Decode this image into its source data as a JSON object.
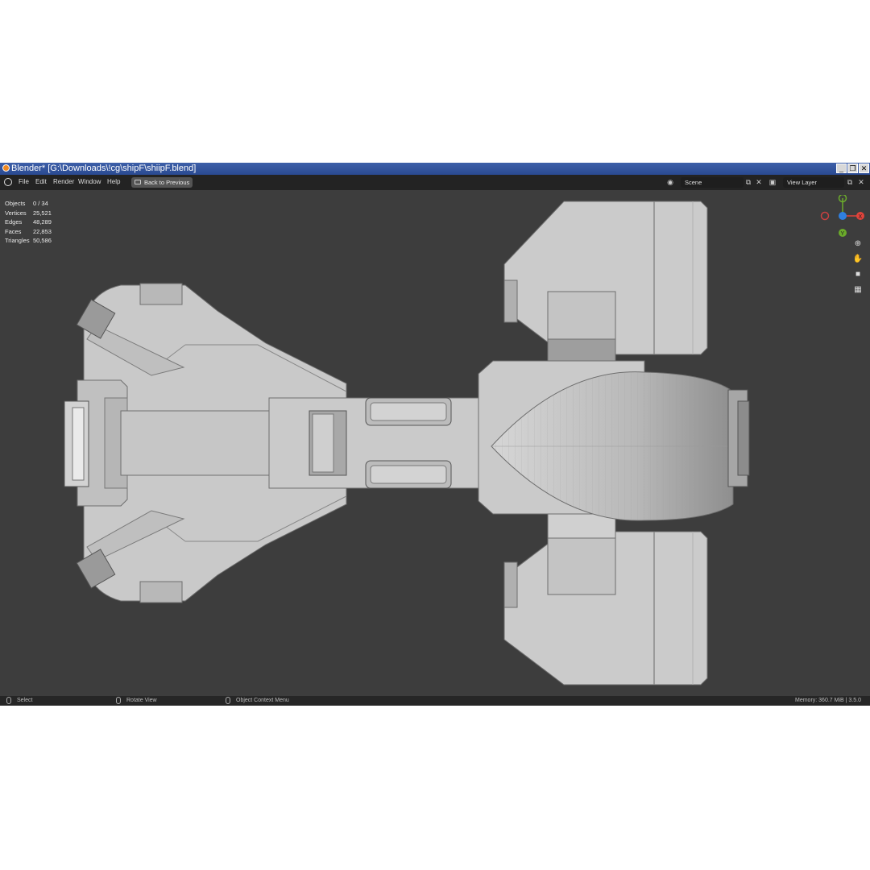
{
  "window": {
    "title": "Blender* [G:\\Downloads\\!cg\\shipF\\shiipF.blend]",
    "controls": [
      "_",
      "❐",
      "✕"
    ]
  },
  "menu": {
    "items": [
      "File",
      "Edit",
      "Render",
      "Window",
      "Help"
    ],
    "back_button": "Back to Previous",
    "scene_field": "Scene",
    "view_layer_field": "View Layer"
  },
  "stats": [
    {
      "label": "Objects",
      "value": "0 / 34"
    },
    {
      "label": "Vertices",
      "value": "25,521"
    },
    {
      "label": "Edges",
      "value": "48,289"
    },
    {
      "label": "Faces",
      "value": "22,853"
    },
    {
      "label": "Triangles",
      "value": "50,586"
    }
  ],
  "gizmo": {
    "axes": [
      "X",
      "Y"
    ]
  },
  "status": {
    "select": "Select",
    "rotate": "Rotate View",
    "context": "Object Context Menu",
    "memory": "Memory: 360.7 MiB | 3.5.0"
  },
  "colors": {
    "axis_x": "#e0433b",
    "axis_y": "#6bab2b",
    "axis_z": "#2f7fe0",
    "model": "#c8c8c8"
  }
}
